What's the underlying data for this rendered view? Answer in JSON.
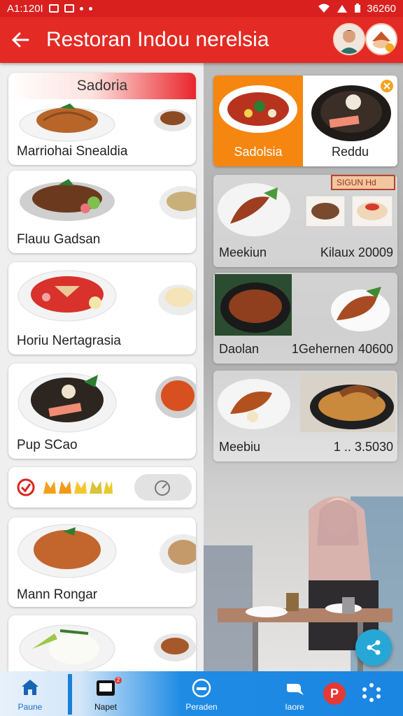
{
  "status_bar": {
    "time_text": "A1:120I",
    "battery_text": "36260"
  },
  "app_bar": {
    "title": "Restoran Indou nerelsia"
  },
  "left_cards": [
    {
      "header": "Sadoria",
      "title": "Marriohai Snealdia"
    },
    {
      "title": "Flauu Gadsan"
    },
    {
      "title": "Horiu Nertagrasia"
    },
    {
      "title": "Pup SCao"
    },
    {
      "title": "Mann Rongar"
    }
  ],
  "featured": {
    "left_label": "Sadolsia",
    "right_label": "Reddu"
  },
  "right_cards": [
    {
      "left_label": "Meekiun",
      "right_label": "Kilaux 20009",
      "sign_text": "SIGUN Hd"
    },
    {
      "left_label": "Daolan",
      "right_label": "1Gehernen 40600"
    },
    {
      "left_label": "Meebiu",
      "right_label": "1 .. 3.5030"
    }
  ],
  "bottom_nav": [
    {
      "label": "Paune",
      "icon": "home-icon"
    },
    {
      "label": "Napet",
      "icon": "tablet-icon",
      "badge": "2"
    },
    {
      "label": "Peraden",
      "icon": "dish-icon"
    },
    {
      "label": "Iaore",
      "icon": "chat-icon"
    },
    {
      "label": "",
      "icon": "dots-icon"
    }
  ],
  "profile_badge": "P",
  "colors": {
    "primary": "#e42a24",
    "orange": "#f5860f",
    "nav_blue": "#1a86e2",
    "fab": "#27a7d5"
  }
}
